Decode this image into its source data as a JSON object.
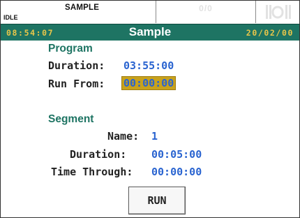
{
  "status_bar": {
    "batch_name": "SAMPLE",
    "run_state": "IDLE",
    "counter": "0/0",
    "alarm_icon": "alarm-bell-icon"
  },
  "title_bar": {
    "time": "08:54:07",
    "title": "Sample",
    "date": "20/02/00"
  },
  "program": {
    "heading": "Program",
    "duration_label": "Duration:",
    "duration_value": "03:55:00",
    "run_from_label": "Run From:",
    "run_from_value": "00:00:00"
  },
  "segment": {
    "heading": "Segment",
    "name_label": "Name:",
    "name_value": "1",
    "duration_label": "Duration:",
    "duration_value": "00:05:00",
    "time_through_label": "Time Through:",
    "time_through_value": "00:00:00"
  },
  "actions": {
    "run_label": "RUN"
  },
  "colors": {
    "title_bar_bg": "#1e7463",
    "section_heading": "#1e7463",
    "value_text": "#2a64d0",
    "clock_text": "#e8c64a",
    "selected_field_bg": "#c8a21c"
  }
}
